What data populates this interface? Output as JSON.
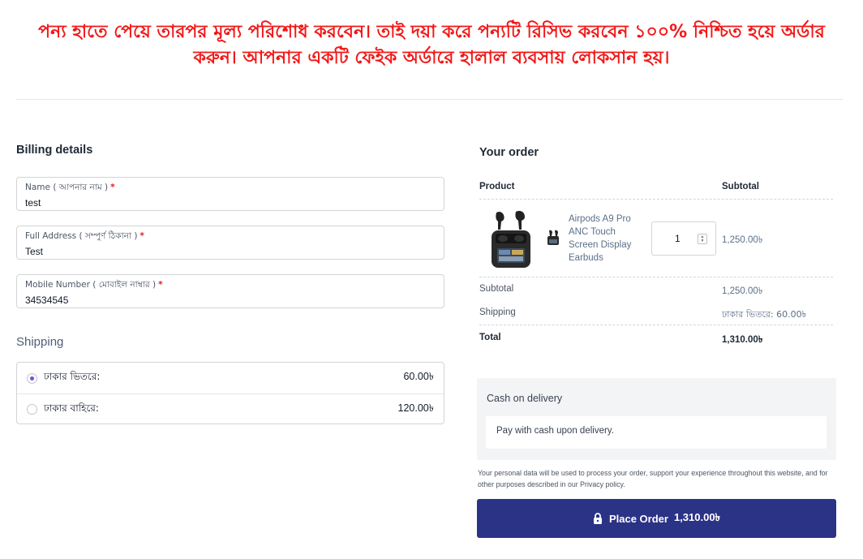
{
  "notice": "পন্য হাতে পেয়ে তারপর মূল্য পরিশোধ করবেন। তাই দয়া করে পন্যটি রিসিভ করবেন ১০০% নিশ্চিত হয়ে অর্ডার করুন। আপনার একটি ফেইক অর্ডারে হালাল ব্যবসায় লোকসান হয়।",
  "billing": {
    "title": "Billing details",
    "fields": [
      {
        "label": "Name ( আপনার নাম )",
        "required": "*",
        "value": "test"
      },
      {
        "label": "Full Address ( সম্পুর্ণ ঠিকানা )",
        "required": "*",
        "value": "Test"
      },
      {
        "label": "Mobile Number ( মোবাইল নাম্বার )",
        "required": "*",
        "value": "34534545"
      }
    ]
  },
  "shipping": {
    "title": "Shipping",
    "options": [
      {
        "name": "ঢাকার ভিতরে:",
        "price": "60.00৳",
        "selected": true
      },
      {
        "name": "ঢাকার বাহিরে:",
        "price": "120.00৳",
        "selected": false
      }
    ]
  },
  "order": {
    "title": "Your order",
    "col_product": "Product",
    "col_subtotal": "Subtotal",
    "item": {
      "name": "Airpods A9 Pro ANC Touch Screen Display Earbuds",
      "quantity": "1",
      "subtotal": "1,250.00৳"
    },
    "subtotal_label": "Subtotal",
    "subtotal_value": "1,250.00৳",
    "shipping_label": "Shipping",
    "shipping_value": "ঢাকার ভিতরে: 60.00৳",
    "total_label": "Total",
    "total_value": "1,310.00৳"
  },
  "payment": {
    "method": "Cash on delivery",
    "description": "Pay with cash upon delivery."
  },
  "privacy_text": "Your personal data will be used to process your order, support your experience throughout this website, and for other purposes described in our Privacy policy.",
  "place_order": {
    "label": "Place Order",
    "amount": "1,310.00৳"
  },
  "colors": {
    "notice": "#f21818",
    "button": "#2b3386",
    "radio_accent": "#7c4ddb",
    "required_star": "#e11d1d"
  },
  "icons": [
    "lock-icon",
    "radio-selected-icon",
    "radio-unselected-icon",
    "quantity-spinner-icon"
  ]
}
